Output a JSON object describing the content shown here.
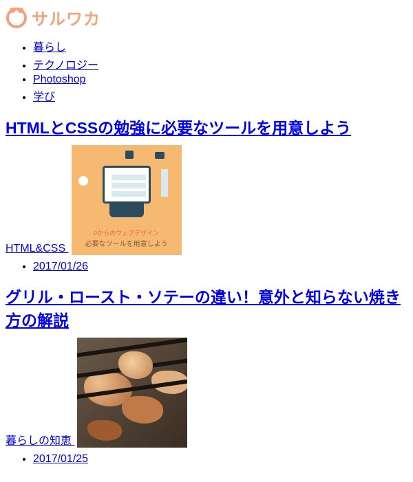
{
  "logo": {
    "text": "サルワカ"
  },
  "nav": {
    "items": [
      {
        "label": "暮らし"
      },
      {
        "label": "テクノロジー"
      },
      {
        "label": "Photoshop"
      },
      {
        "label": "学び"
      }
    ]
  },
  "articles": [
    {
      "title": "HTMLとCSSの勉強に必要なツールを用意しよう",
      "category": "HTML&CSS",
      "date": "2017/01/26",
      "thumb": {
        "caption_small": "0からのウェブデザイン",
        "caption_large": "必要なツールを用意しよう"
      }
    },
    {
      "title": "グリル・ロースト・ソテーの違い！意外と知らない焼き方の解説",
      "category": "暮らしの知恵",
      "date": "2017/01/25"
    }
  ]
}
